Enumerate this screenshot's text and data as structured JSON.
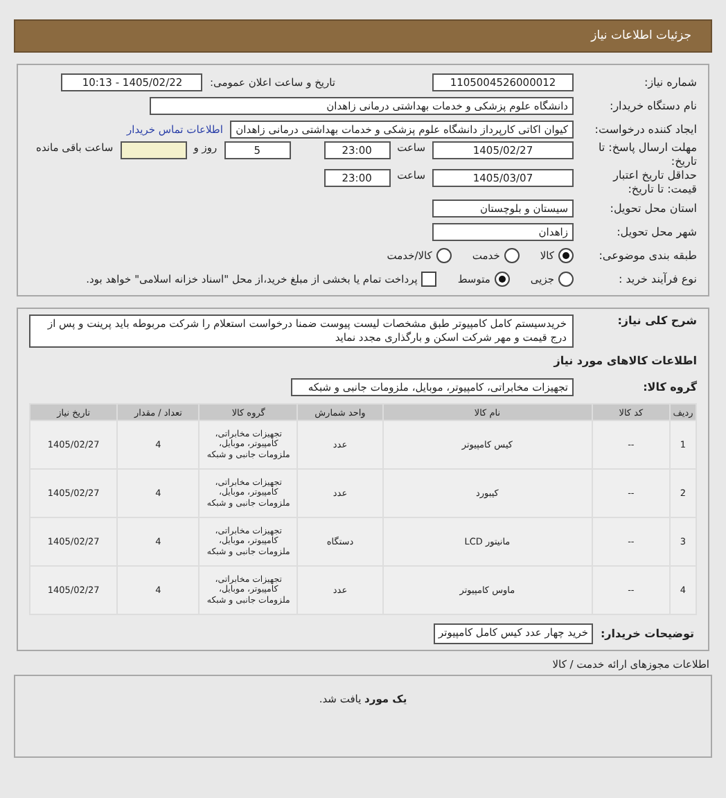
{
  "header": {
    "title": "جزئیات اطلاعات نیاز"
  },
  "need_number": {
    "label": "شماره نیاز:",
    "value": "1105004526000012"
  },
  "announce": {
    "label": "تاریخ و ساعت اعلان عمومی:",
    "value": "1405/02/22 - 10:13"
  },
  "buyer": {
    "label": "نام دستگاه خریدار:",
    "value": "دانشگاه علوم پزشکی و خدمات بهداشتی درمانی زاهدان"
  },
  "requester": {
    "label": "ایجاد کننده درخواست:",
    "value": "کیوان اکاتی کارپرداز دانشگاه علوم پزشکی و خدمات بهداشتی درمانی زاهدان",
    "link": "اطلاعات تماس خریدار"
  },
  "deadline": {
    "label": "مهلت ارسال پاسخ: تا تاریخ:",
    "date": "1405/02/27",
    "time_label": "ساعت",
    "time": "23:00",
    "days": "5",
    "days_label": "روز و",
    "remaining_label": "ساعت باقی مانده"
  },
  "validity": {
    "label": "حداقل تاریخ اعتبار قیمت: تا تاریخ:",
    "date": "1405/03/07",
    "time_label": "ساعت",
    "time": "23:00"
  },
  "province": {
    "label": "استان محل تحویل:",
    "value": "سیستان و بلوچستان"
  },
  "city": {
    "label": "شهر محل تحویل:",
    "value": "زاهدان"
  },
  "category": {
    "label": "طبقه بندی موضوعی:",
    "options": [
      {
        "label": "کالا",
        "selected": true
      },
      {
        "label": "خدمت",
        "selected": false
      },
      {
        "label": "کالا/خدمت",
        "selected": false
      }
    ]
  },
  "process": {
    "label": "نوع فرآیند خرید :",
    "options": [
      {
        "label": "جزیی",
        "selected": false
      },
      {
        "label": "متوسط",
        "selected": true
      }
    ],
    "treasury": {
      "checked": false,
      "label": "پرداخت تمام یا بخشی از مبلغ خرید،از محل \"اسناد خزانه اسلامی\" خواهد بود."
    }
  },
  "description": {
    "label": "شرح کلی نیاز:",
    "text": "خریدسیستم کامل کامپیوتر طبق مشخصات لیست پیوست ضمنا درخواست استعلام را شرکت مربوطه باید پرینت و پس از درج قیمت و مهر شرکت اسکن و بارگذاری مجدد نماید"
  },
  "goods_title": "اطلاعات کالاهای مورد نیاز",
  "goods_group": {
    "label": "گروه کالا:",
    "value": "تجهیزات مخابراتی، کامپیوتر، موبایل، ملزومات جانبی و شبکه"
  },
  "table": {
    "columns": [
      "ردیف",
      "کد کالا",
      "نام کالا",
      "واحد شمارش",
      "گروه کالا",
      "تعداد / مقدار",
      "تاریخ نیاز"
    ],
    "rows": [
      [
        "1",
        "--",
        "کیس کامپیوتر",
        "عدد",
        "تجهیزات مخابراتی، کامپیوتر، موبایل، ملزومات جانبی و شبکه",
        "4",
        "1405/02/27"
      ],
      [
        "2",
        "--",
        "کیبورد",
        "عدد",
        "تجهیزات مخابراتی، کامپیوتر، موبایل، ملزومات جانبی و شبکه",
        "4",
        "1405/02/27"
      ],
      [
        "3",
        "--",
        "مانیتور LCD",
        "دستگاه",
        "تجهیزات مخابراتی، کامپیوتر، موبایل، ملزومات جانبی و شبکه",
        "4",
        "1405/02/27"
      ],
      [
        "4",
        "--",
        "ماوس کامپیوتر",
        "عدد",
        "تجهیزات مخابراتی، کامپیوتر، موبایل، ملزومات جانبی و شبکه",
        "4",
        "1405/02/27"
      ]
    ]
  },
  "buyer_notes": {
    "label": "توضیحات خریدار:",
    "value": "خرید چهار عدد کیس کامل کامپیوتر"
  },
  "licenses": {
    "title": "اطلاعات مجوزهای ارائه خدمت / کالا",
    "result": "**یک مورد** یافت شد."
  }
}
